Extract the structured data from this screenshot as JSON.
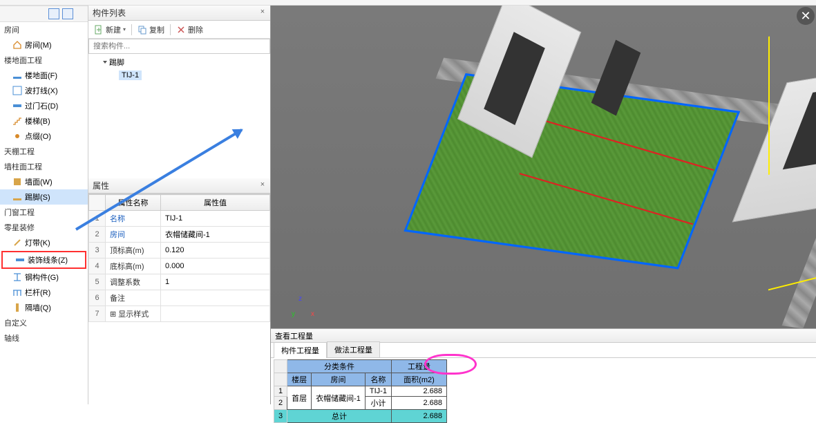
{
  "nav": {
    "room_hdr": "房间",
    "room": "房间(M)",
    "floor_hdr": "楼地面工程",
    "floor": "楼地面(F)",
    "bodax": "波打线(X)",
    "gms": "过门石(D)",
    "stair": "楼梯(B)",
    "dianzhui": "点缀(O)",
    "ceiling_hdr": "天棚工程",
    "wallcol_hdr": "墙柱面工程",
    "qiangmian": "墙面(W)",
    "tijiao": "踢脚(S)",
    "doorwin_hdr": "门窗工程",
    "lingxing_hdr": "零星装修",
    "dengdai": "灯带(K)",
    "zhuangshi": "装饰线条(Z)",
    "gangou": "钢构件(G)",
    "langan": "栏杆(R)",
    "geqiang": "隔墙(Q)",
    "zidingyi_hdr": "自定义",
    "zhouxian_hdr": "轴线"
  },
  "componentList": {
    "title": "构件列表",
    "btn_new": "新建",
    "btn_copy": "复制",
    "btn_delete": "删除",
    "search_placeholder": "搜索构件...",
    "root": "踢脚",
    "item": "TIJ-1"
  },
  "props": {
    "title": "属性",
    "col_name": "属性名称",
    "col_value": "属性值",
    "rows": [
      {
        "n": "1",
        "name": "名称",
        "val": "TIJ-1",
        "blue": true
      },
      {
        "n": "2",
        "name": "房间",
        "val": "衣帽储藏间-1",
        "blue": true
      },
      {
        "n": "3",
        "name": "顶标高(m)",
        "val": "0.120",
        "blue": false
      },
      {
        "n": "4",
        "name": "底标高(m)",
        "val": "0.000",
        "blue": false
      },
      {
        "n": "5",
        "name": "调整系数",
        "val": "1",
        "blue": false
      },
      {
        "n": "6",
        "name": "备注",
        "val": "",
        "blue": false
      },
      {
        "n": "7",
        "name": "⊞ 显示样式",
        "val": "",
        "blue": false
      }
    ]
  },
  "gizmo": {
    "x": "x",
    "y": "y",
    "z": "z"
  },
  "bottom": {
    "title": "查看工程量",
    "tab1": "构件工程量",
    "tab2": "做法工程量",
    "hdr_class": "分类条件",
    "hdr_qty": "工程量",
    "c_floor": "楼层",
    "c_room": "房间",
    "c_name": "名称",
    "c_area": "面积(m2)",
    "r1_floor": "首层",
    "r1_room": "衣帽储藏间-1",
    "r1_name": "TIJ-1",
    "r1_val": "2.688",
    "r2_name": "小计",
    "r2_val": "2.688",
    "r3_name": "总计",
    "r3_val": "2.688",
    "rn1": "1",
    "rn2": "2",
    "rn3": "3"
  },
  "chart_data": {
    "type": "table",
    "title": "查看工程量 — 构件工程量",
    "columns": [
      "楼层",
      "房间",
      "名称",
      "面积(m2)"
    ],
    "rows": [
      [
        "首层",
        "衣帽储藏间-1",
        "TIJ-1",
        2.688
      ],
      [
        "首层",
        "衣帽储藏间-1",
        "小计",
        2.688
      ],
      [
        "",
        "",
        "总计",
        2.688
      ]
    ]
  }
}
